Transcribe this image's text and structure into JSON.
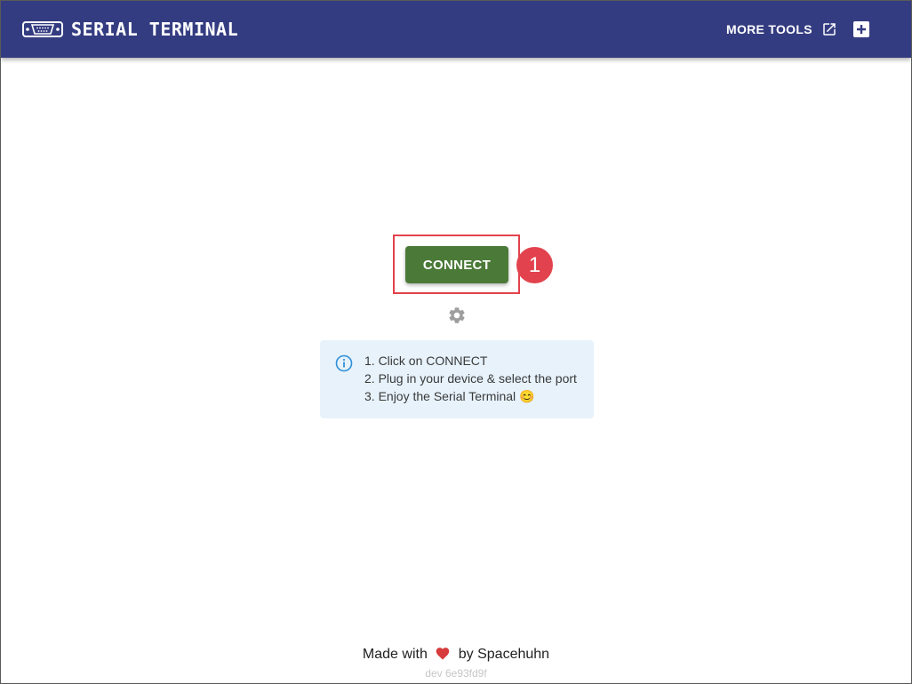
{
  "header": {
    "title": "SERIAL TERMINAL",
    "more_tools_label": "MORE TOOLS",
    "logo_icon": "serial-port-icon",
    "more_tools_icon": "open-in-new-icon",
    "add_icon": "plus-box-icon"
  },
  "main": {
    "connect_label": "CONNECT",
    "step_badge": "1",
    "settings_icon": "gear-icon",
    "info": {
      "icon": "info-icon",
      "lines": [
        "1. Click on CONNECT",
        "2. Plug in your device & select the port",
        "3. Enjoy the Serial Terminal 😊"
      ]
    }
  },
  "footer": {
    "made_with": "Made with",
    "by": "by Spacehuhn",
    "heart_icon": "heart-icon",
    "version": "dev 6e93fd9f"
  },
  "colors": {
    "appbar": "#343c81",
    "connect_button": "#4b7a38",
    "highlight": "#e2424d",
    "info_background": "#e7f2fb"
  }
}
